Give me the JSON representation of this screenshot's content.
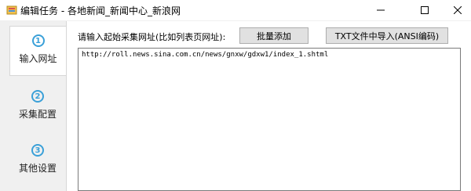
{
  "window": {
    "title": "编辑任务 - 各地新闻_新闻中心_新浪网"
  },
  "sidebar": {
    "items": [
      {
        "number": "1",
        "label": "输入网址",
        "active": true
      },
      {
        "number": "2",
        "label": "采集配置",
        "active": false
      },
      {
        "number": "3",
        "label": "其他设置",
        "active": false
      }
    ]
  },
  "main": {
    "prompt": "请输入起始采集网址(比如列表页网址):",
    "batch_add_label": "批量添加",
    "import_label": "TXT文件中导入(ANSI编码)",
    "url_value": "http://roll.news.sina.com.cn/news/gnxw/gdxw1/index_1.shtml"
  },
  "colors": {
    "accent": "#3aa0d8"
  }
}
